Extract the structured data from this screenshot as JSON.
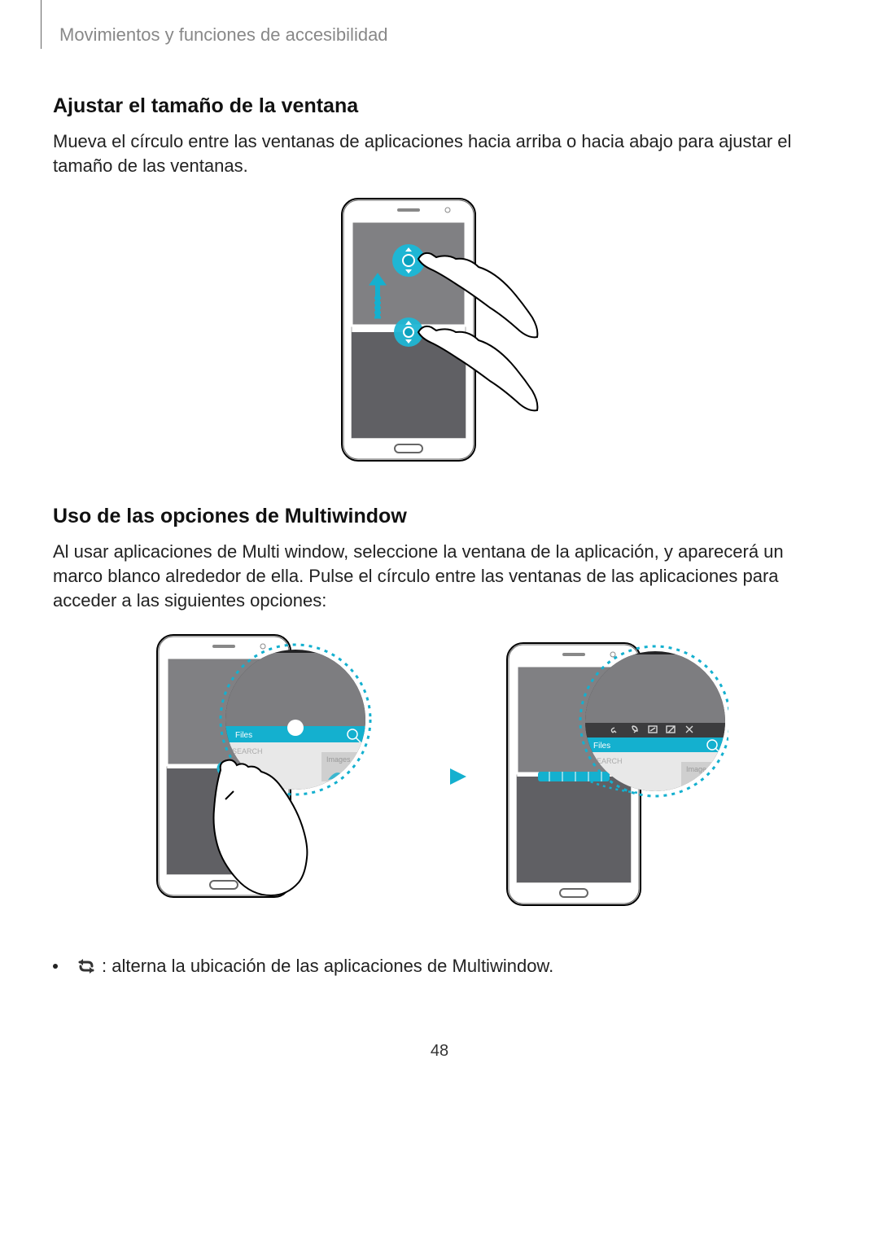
{
  "header": {
    "breadcrumb": "Movimientos y funciones de accesibilidad"
  },
  "section1": {
    "title": "Ajustar el tamaño de la ventana",
    "body": "Mueva el círculo entre las ventanas de aplicaciones hacia arriba o hacia abajo para ajustar el tamaño de las ventanas."
  },
  "section2": {
    "title": "Uso de las opciones de Multiwindow",
    "body": "Al usar aplicaciones de Multi window, seleccione la ventana de la aplicación, y aparecerá un marco blanco alrededor de ella. Pulse el círculo entre las ventanas de las aplicaciones para acceder a las siguientes opciones:"
  },
  "bullet1": {
    "text": " : alterna la ubicación de las aplicaciones de Multiwindow."
  },
  "magnifier": {
    "files_label": "Files",
    "search_label": "SEARCH",
    "images_label": "Images"
  },
  "page_number": "48"
}
